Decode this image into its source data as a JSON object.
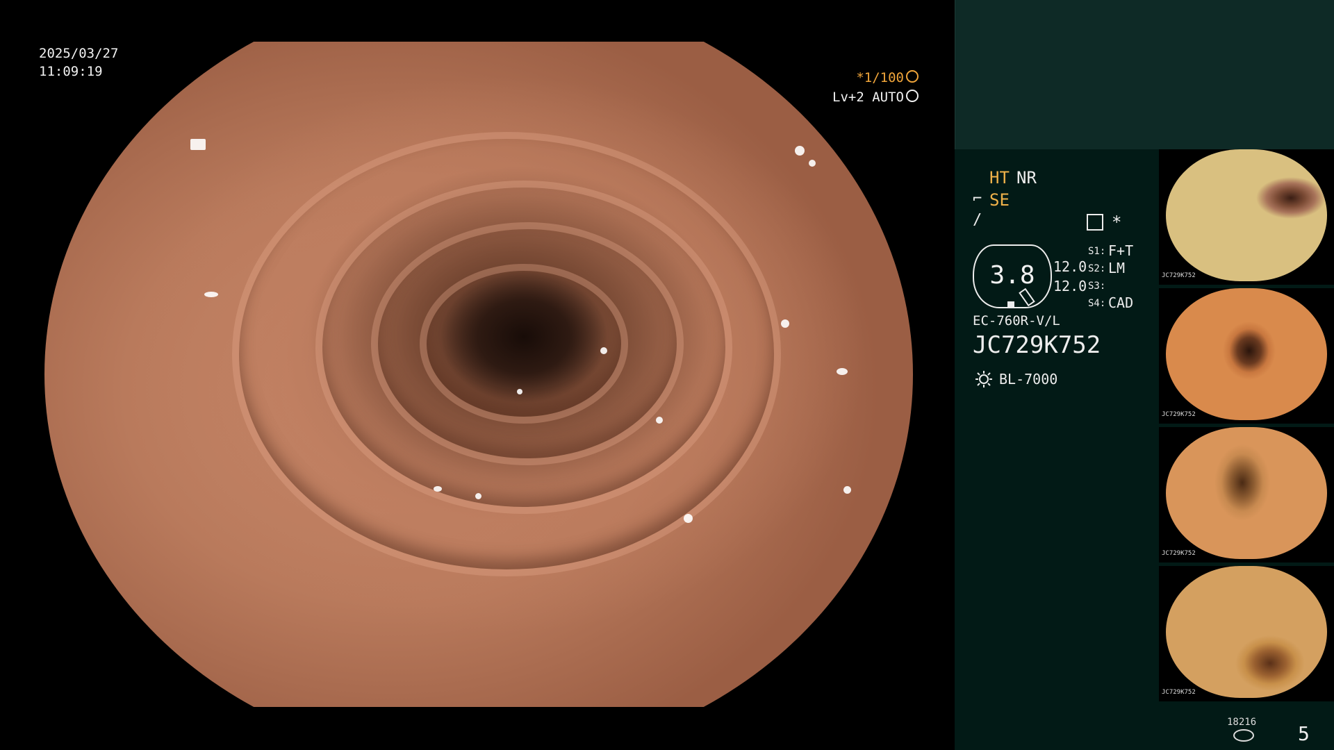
{
  "overlay": {
    "date": "2025/03/27",
    "time": "11:09:19",
    "shutter": "*1/100",
    "level": "Lv+2 AUTO"
  },
  "panel": {
    "ht": "HT",
    "nr": "NR",
    "se": "SE",
    "gauge_value": "3.8",
    "val1": "12.0",
    "val2": "12.0",
    "s1_label": "S1:",
    "s1_value": "F+T",
    "s2_label": "S2:",
    "s2_value": "LM",
    "s3_label": "S3:",
    "s3_value": "",
    "s4_label": "S4:",
    "s4_value": "CAD",
    "scope_model": "EC-760R-V/L",
    "scope_serial": "JC729K752",
    "light_source": "BL-7000",
    "asterisk": "*",
    "disk_count": "18216",
    "image_count": "5"
  },
  "thumbnails": [
    {
      "label": "JC729K752"
    },
    {
      "label": "JC729K752"
    },
    {
      "label": "JC729K752"
    },
    {
      "label": "JC729K752"
    }
  ],
  "colors": {
    "panel_bg": "#021a16",
    "panel_top_bg": "#0e2a26",
    "accent_yellow": "#f0b24a",
    "shutter_orange": "#f0a53a"
  }
}
